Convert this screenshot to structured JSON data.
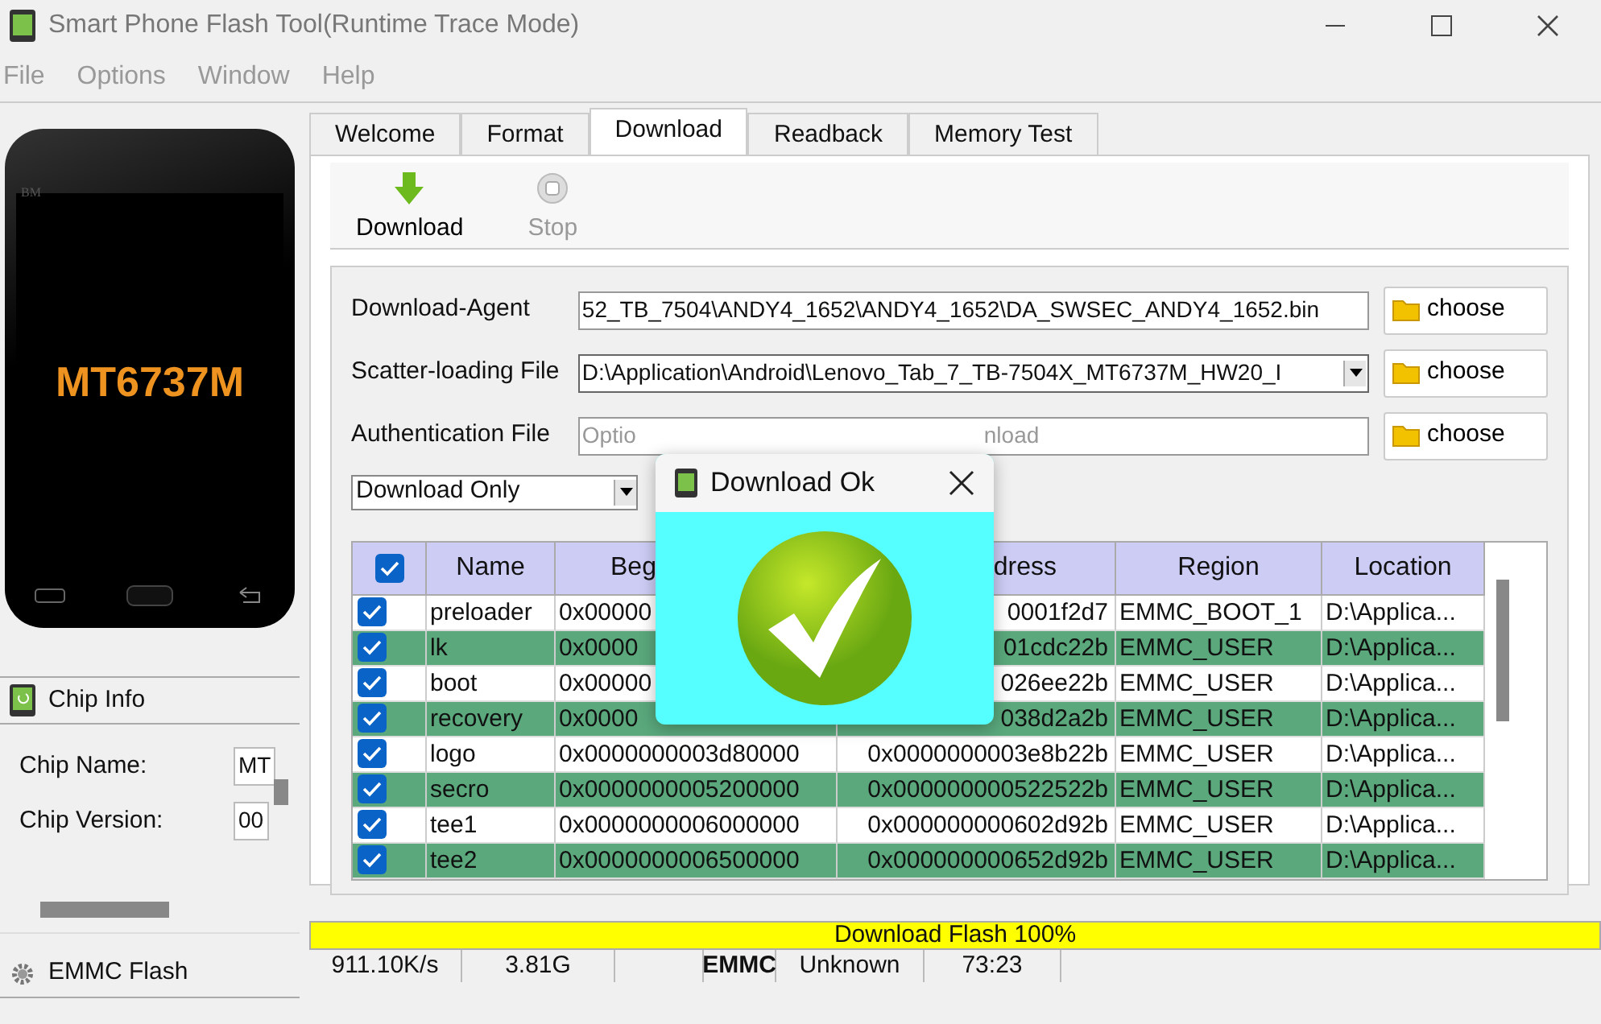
{
  "window": {
    "title": "Smart Phone Flash Tool(Runtime Trace Mode)"
  },
  "menu": [
    "File",
    "Options",
    "Window",
    "Help"
  ],
  "phone": {
    "brand_mark": "BM",
    "chip": "MT6737M"
  },
  "chip_info": {
    "title": "Chip Info",
    "fields": [
      {
        "label": "Chip Name:",
        "value": "MT"
      },
      {
        "label": "Chip Version:",
        "value": "00"
      }
    ]
  },
  "emmc_panel": {
    "title": "EMMC Flash"
  },
  "tabs": [
    {
      "label": "Welcome",
      "selected": false
    },
    {
      "label": "Format",
      "selected": false
    },
    {
      "label": "Download",
      "selected": true
    },
    {
      "label": "Readback",
      "selected": false
    },
    {
      "label": "Memory Test",
      "selected": false
    }
  ],
  "toolbar": [
    {
      "label": "Download",
      "kind": "download",
      "disabled": false
    },
    {
      "label": "Stop",
      "kind": "stop",
      "disabled": true
    }
  ],
  "files": [
    {
      "label": "Download-Agent",
      "kind": "text",
      "value": "52_TB_7504\\ANDY4_1652\\ANDY4_1652\\DA_SWSEC_ANDY4_1652.bin",
      "button": "choose"
    },
    {
      "label": "Scatter-loading File",
      "kind": "combo",
      "value": "D:\\Application\\Android\\Lenovo_Tab_7_TB-7504X_MT6737M_HW20_I",
      "button": "choose"
    },
    {
      "label": "Authentication File",
      "kind": "placeholder",
      "value_start": "Optio",
      "value_end": "nload",
      "button": "choose"
    }
  ],
  "mode": {
    "value": "Download Only"
  },
  "table": {
    "header_checked": true,
    "columns": [
      "Name",
      "Beg",
      "dress",
      "Region",
      "Location"
    ],
    "rows": [
      {
        "checked": true,
        "highlighted": false,
        "cells": [
          "preloader",
          "0x00000",
          "0001f2d7",
          "EMMC_BOOT_1",
          "D:\\Applica..."
        ]
      },
      {
        "checked": true,
        "highlighted": true,
        "cells": [
          "lk",
          "0x0000",
          "01cdc22b",
          "EMMC_USER",
          "D:\\Applica..."
        ]
      },
      {
        "checked": true,
        "highlighted": false,
        "cells": [
          "boot",
          "0x00000",
          "026ee22b",
          "EMMC_USER",
          "D:\\Applica..."
        ]
      },
      {
        "checked": true,
        "highlighted": true,
        "cells": [
          "recovery",
          "0x0000",
          "038d2a2b",
          "EMMC_USER",
          "D:\\Applica..."
        ]
      },
      {
        "checked": true,
        "highlighted": false,
        "cells": [
          "logo",
          "0x0000000003d80000",
          "0x0000000003e8b22b",
          "EMMC_USER",
          "D:\\Applica..."
        ]
      },
      {
        "checked": true,
        "highlighted": true,
        "cells": [
          "secro",
          "0x0000000005200000",
          "0x000000000522522b",
          "EMMC_USER",
          "D:\\Applica..."
        ]
      },
      {
        "checked": true,
        "highlighted": false,
        "cells": [
          "tee1",
          "0x0000000006000000",
          "0x000000000602d92b",
          "EMMC_USER",
          "D:\\Applica..."
        ]
      },
      {
        "checked": true,
        "highlighted": true,
        "cells": [
          "tee2",
          "0x0000000006500000",
          "0x000000000652d92b",
          "EMMC_USER",
          "D:\\Applica..."
        ]
      }
    ]
  },
  "dialog": {
    "title": "Download Ok"
  },
  "progress": {
    "label": "Download Flash 100%",
    "level": 1
  },
  "status_bar": [
    {
      "text": "911.10K/s",
      "bold": false
    },
    {
      "text": "3.81G",
      "bold": false
    },
    {
      "text": "EMMC",
      "bold": true
    },
    {
      "text": "Unknown",
      "bold": false
    },
    {
      "text": "73:23",
      "bold": false
    }
  ]
}
